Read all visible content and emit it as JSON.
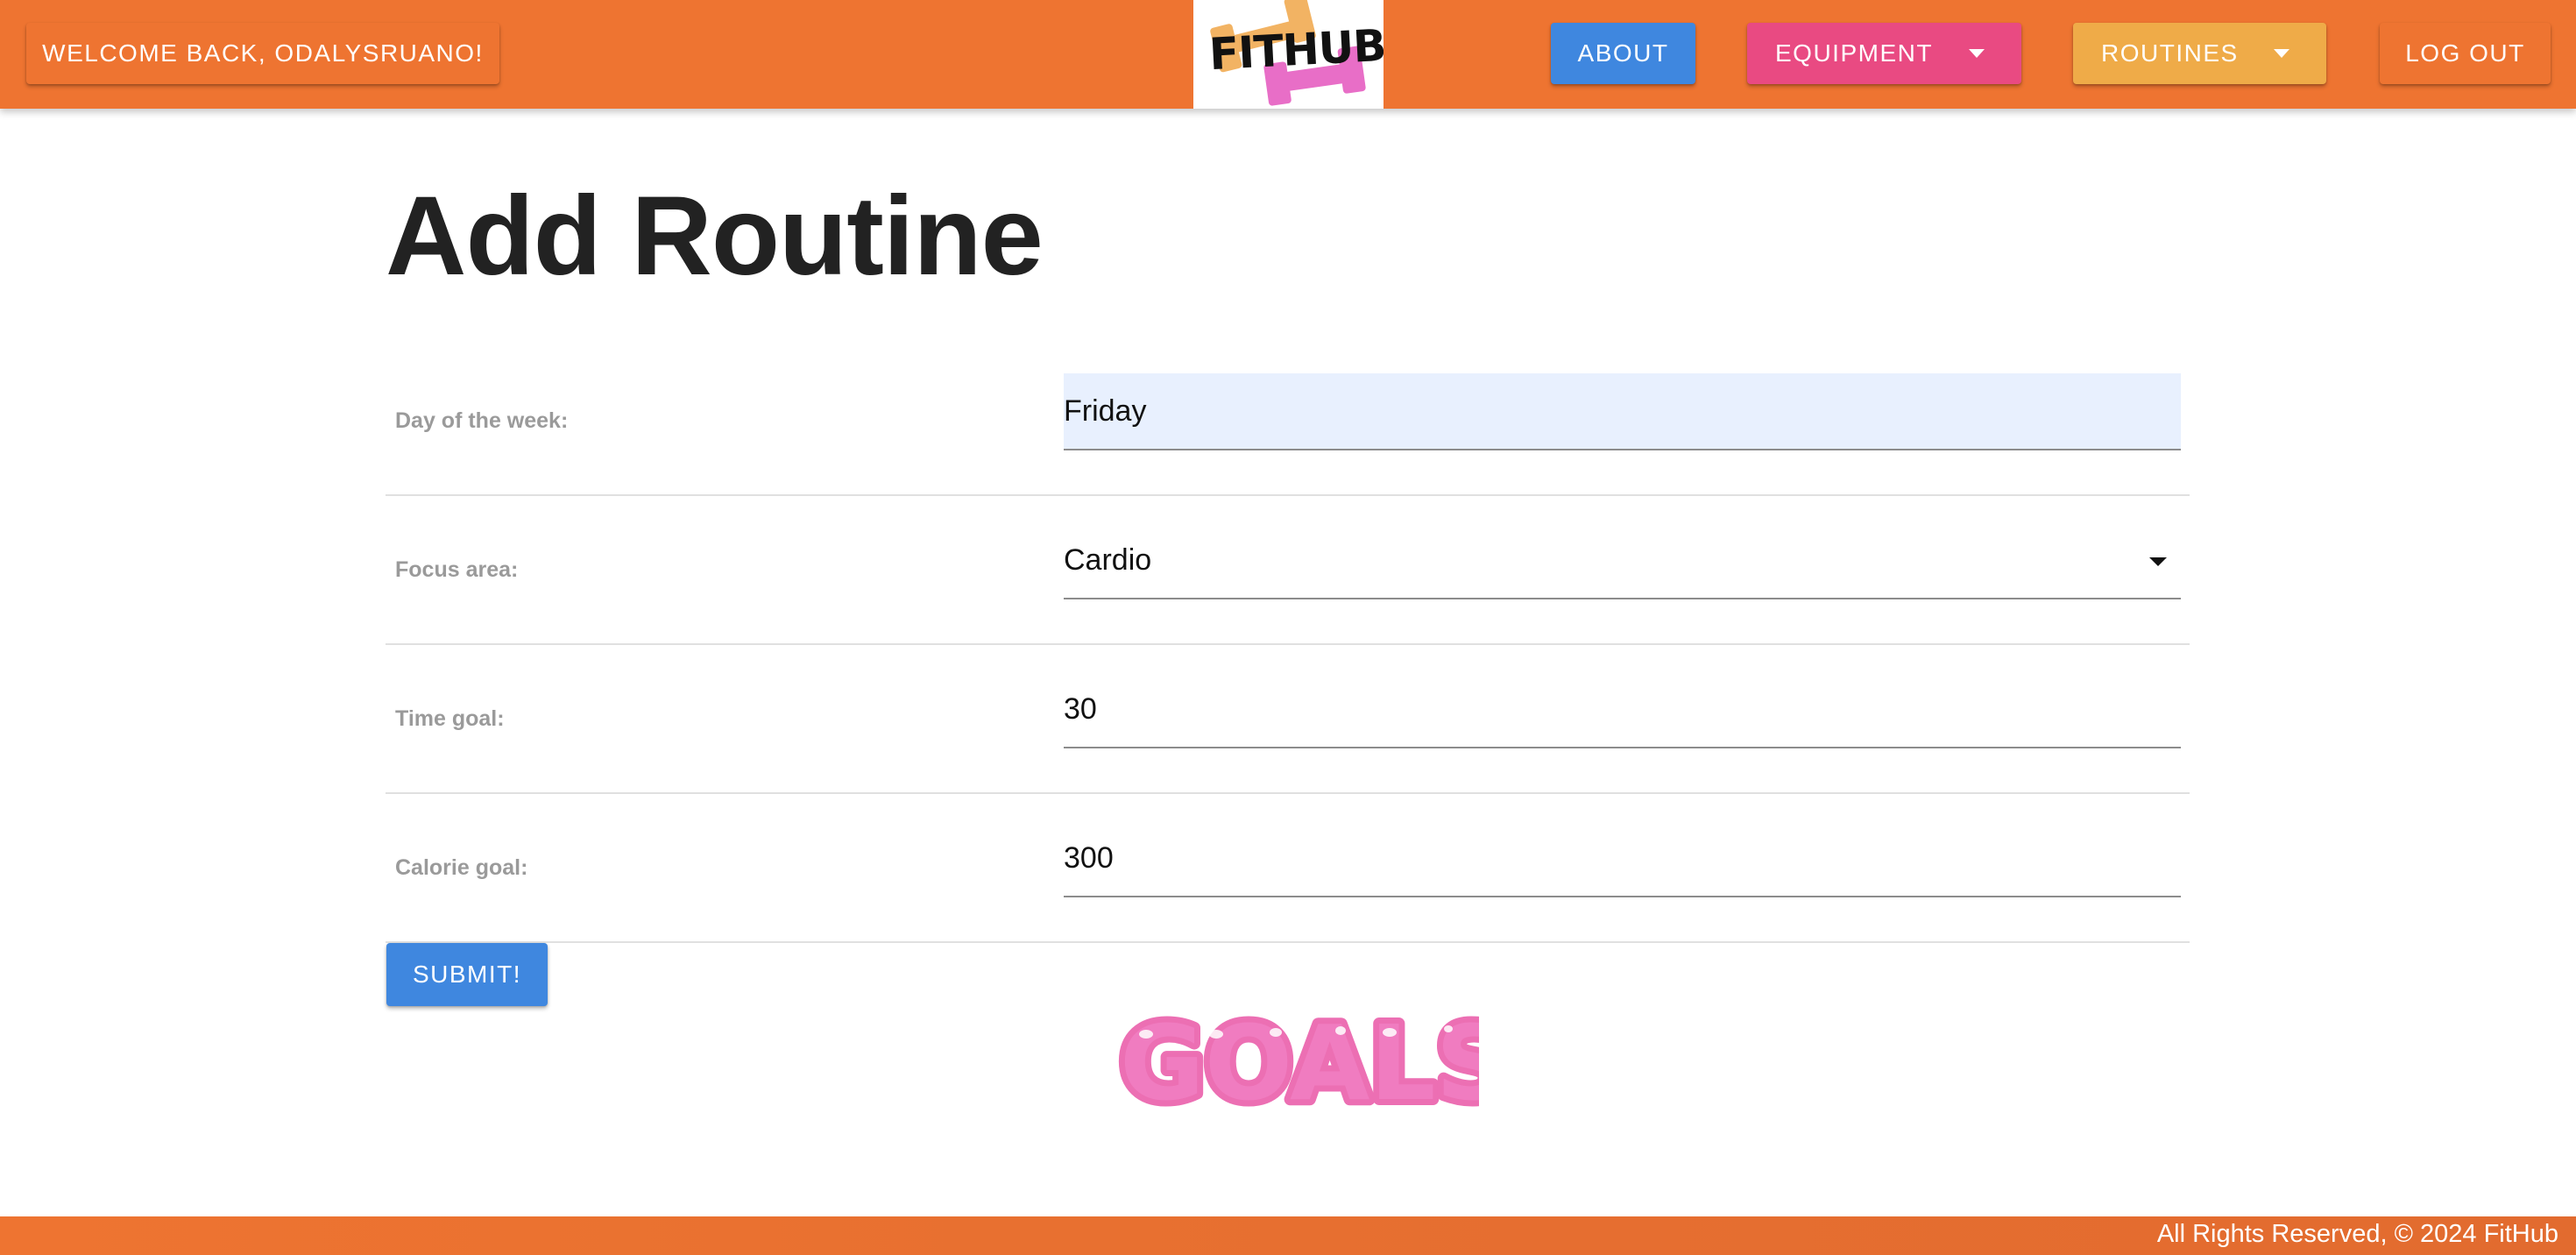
{
  "navbar": {
    "welcome_label": "WELCOME BACK, ODALYSRUANO!",
    "logo_text": "FITHUB",
    "about_label": "ABOUT",
    "equipment_label": "EQUIPMENT",
    "routines_label": "ROUTINES",
    "logout_label": "LOG OUT",
    "bar_color": "#ee7431",
    "about_color": "#3f87df",
    "equipment_color": "#e94a82",
    "routines_color": "#efab48"
  },
  "page": {
    "title": "Add Routine"
  },
  "form": {
    "fields": [
      {
        "label": "Day of the week:",
        "value": "Friday"
      },
      {
        "label": "Focus area:",
        "value": "Cardio"
      },
      {
        "label": "Time goal:",
        "value": "30"
      },
      {
        "label": "Calorie goal:",
        "value": "300"
      }
    ],
    "submit_label": "SUBMIT!"
  },
  "goals_image": {
    "text": "GOALS!",
    "color": "#ec6fb3"
  },
  "footer": {
    "text": "All Rights Reserved, © 2024 FitHub"
  },
  "icons": [
    "dropdown-caret-icon",
    "fithub-logo"
  ]
}
